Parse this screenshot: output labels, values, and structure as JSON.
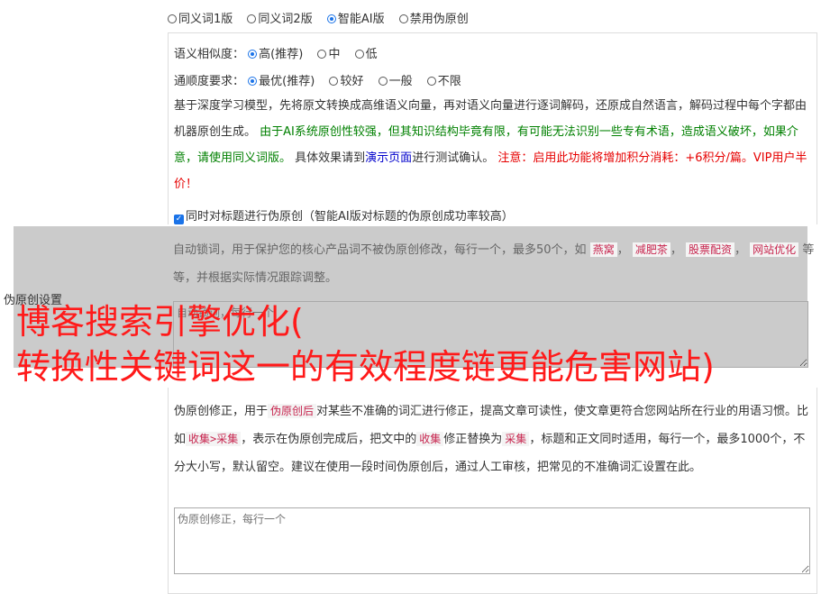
{
  "mode": {
    "options": [
      "同义词1版",
      "同义词2版",
      "智能AI版",
      "禁用伪原创"
    ],
    "selected": 2
  },
  "similarity": {
    "label": "语义相似度：",
    "options": [
      "高(推荐)",
      "中",
      "低"
    ],
    "selected": 0
  },
  "fluency": {
    "label": "通顺度要求：",
    "options": [
      "最优(推荐)",
      "较好",
      "一般",
      "不限"
    ],
    "selected": 0
  },
  "description": {
    "intro": "基于深度学习模型，先将原文转换成高维语义向量，再对语义向量进行逐词解码，还原成自然语言，解码过程中每个字都由机器原创生成。",
    "green_note": "由于AI系统原创性较强，但其知识结构毕竟有限，有可能无法识别一些专有术语，造成语义破坏，如果介意，请使用同义词版。",
    "test_prefix": "具体效果请到",
    "test_link": "演示页面",
    "test_suffix": "进行测试确认。",
    "red_note": "注意：启用此功能将增加积分消耗：+6积分/篇。VIP用户半价！"
  },
  "title_checkbox": {
    "label": "同时对标题进行伪原创（智能AI版对标题的伪原创成功率较高）",
    "checked": true
  },
  "lock_words": {
    "text_prefix": "自动锁词，用于保护您的核心产品词不被伪原创修改，每行一个，最多50个，如",
    "examples": [
      "燕窝",
      "减肥茶",
      "股票配资",
      "网站优化"
    ],
    "text_suffix": "等等，并根据实际情况跟踪调整。",
    "placeholder": "自动锁词，每行一个"
  },
  "side_label": "伪原创设置",
  "overlay": {
    "line1": "博客搜索引擎优化(",
    "line2": "转换性关键词这一的有效程度链更能危害网站)"
  },
  "correction": {
    "p1": "伪原创修正，用于",
    "tag1": "伪原创后",
    "p2": "对某些不准确的词汇进行修正，提高文章可读性，使文章更符合您网站所在行业的用语习惯。比如",
    "tag2": "收集>采集",
    "p3": "，表示在伪原创完成后，把文中的",
    "tag3": "收集",
    "p4": "修正替换为",
    "tag4": "采集",
    "p5": "，标题和正文同时适用，每行一个，最多1000个，不分大小写，默认留空。建议在使用一段时间伪原创后，通过人工审核，把常见的不准确词汇设置在此。",
    "placeholder": "伪原创修正，每行一个"
  }
}
